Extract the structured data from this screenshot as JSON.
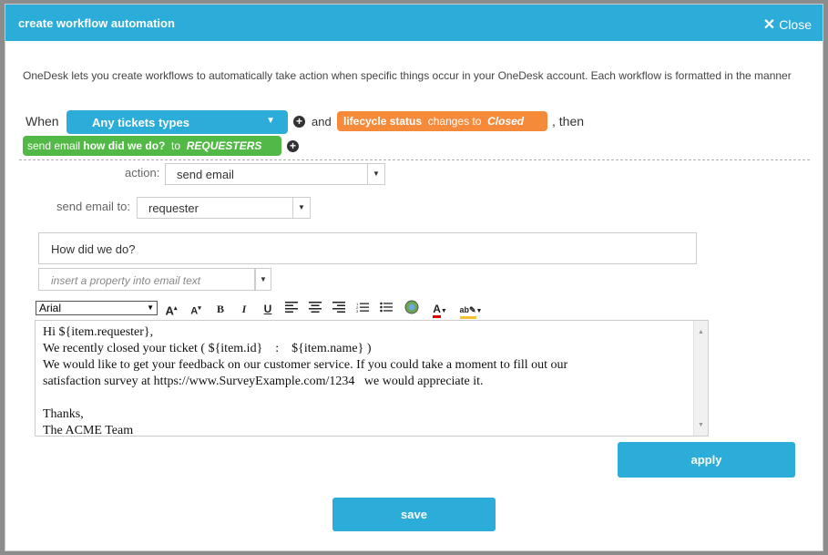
{
  "dialog": {
    "title": "create workflow automation",
    "close_label": "Close"
  },
  "intro_text": "OneDesk lets you create workflows to automatically take action when specific things occur in your OneDesk account. Each workflow is formatted in the manner",
  "rule": {
    "when_label": "When",
    "ticket_type": "Any tickets types",
    "and_label": "and",
    "condition": {
      "property": "lifecycle status",
      "operator": "changes to",
      "value": "Closed"
    },
    "then_label": ", then",
    "action": {
      "verb": "send email",
      "subject": "how did we do?",
      "to_label": "to",
      "recipient": "REQUESTERS"
    }
  },
  "form": {
    "action_label": "action:",
    "action_value": "send email",
    "send_to_label": "send email to:",
    "send_to_value": "requester",
    "subject_value": "How did we do?",
    "insert_placeholder": "insert a property into email text",
    "font_value": "Arial",
    "body_lines": [
      "Hi ${item.requester},",
      "We recently closed your ticket ( ${item.id}    :    ${item.name} )",
      "We would like to get your feedback on our customer service. If you could take a moment to fill out our",
      "satisfaction survey at https://www.SurveyExample.com/1234   we would appreciate it.",
      "",
      "Thanks,",
      "The ACME Team"
    ]
  },
  "toolbar": {
    "increase_font": "A",
    "decrease_font": "A",
    "bold": "B",
    "italic": "I",
    "underline": "U"
  },
  "buttons": {
    "apply": "apply",
    "save": "save"
  },
  "colors": {
    "accent": "#2bacd9",
    "orange": "#f58a3b",
    "green": "#52b946"
  }
}
